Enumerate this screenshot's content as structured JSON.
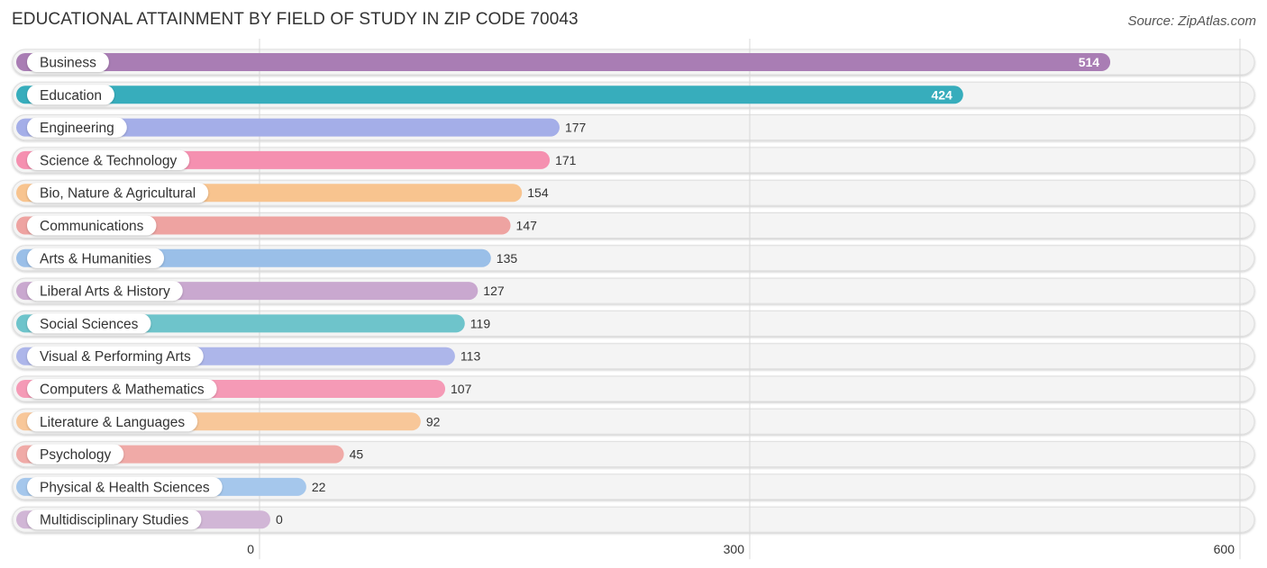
{
  "chart_data": {
    "type": "bar",
    "orientation": "horizontal",
    "title": "EDUCATIONAL ATTAINMENT BY FIELD OF STUDY IN ZIP CODE 70043",
    "source": "Source: ZipAtlas.com",
    "xlabel": "",
    "ylabel": "",
    "xlim": [
      0,
      600
    ],
    "xticks": [
      0,
      300,
      600
    ],
    "grid": true,
    "legend": "none",
    "categories": [
      "Business",
      "Education",
      "Engineering",
      "Science & Technology",
      "Bio, Nature & Agricultural",
      "Communications",
      "Arts & Humanities",
      "Liberal Arts & History",
      "Social Sciences",
      "Visual & Performing Arts",
      "Computers & Mathematics",
      "Literature & Languages",
      "Psychology",
      "Physical & Health Sciences",
      "Multidisciplinary Studies"
    ],
    "values": [
      514,
      424,
      177,
      171,
      154,
      147,
      135,
      127,
      119,
      113,
      107,
      92,
      45,
      22,
      0
    ],
    "colors": [
      "#a97db4",
      "#37adbc",
      "#a4aee8",
      "#f590b0",
      "#f8c48f",
      "#eea3a1",
      "#9abfe8",
      "#c9a8cf",
      "#6ec4cb",
      "#adb6ea",
      "#f59ab6",
      "#f8c799",
      "#f0aaa7",
      "#a5c7ec",
      "#d1b6d6"
    ]
  }
}
